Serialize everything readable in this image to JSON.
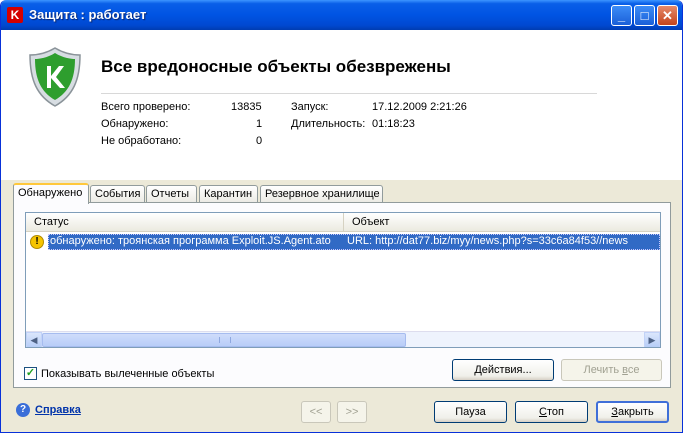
{
  "window": {
    "title": "Защита : работает",
    "logo_letter": "K"
  },
  "header": {
    "title": "Все вредоносные объекты обезврежены",
    "stats": {
      "checked_label": "Всего проверено:",
      "checked_value": "13835",
      "found_label": "Обнаружено:",
      "found_value": "1",
      "unprocessed_label": "Не обработано:",
      "unprocessed_value": "0",
      "start_label": "Запуск:",
      "start_value": "17.12.2009 2:21:26",
      "duration_label": "Длительность:",
      "duration_value": "01:18:23"
    }
  },
  "tabs": [
    "Обнаружено",
    "События",
    "Отчеты",
    "Карантин",
    "Резервное хранилище"
  ],
  "table": {
    "columns": [
      "Статус",
      "Объект"
    ],
    "rows": [
      {
        "status": "обнаружено: троянская программа Exploit.JS.Agent.ato",
        "object": "URL: http://dat77.biz/myy/news.php?s=33c6a84f53//news"
      }
    ]
  },
  "show_cured": {
    "label": "Показывать вылеченные объекты",
    "checked": true
  },
  "buttons": {
    "actions": "Действия...",
    "cure_prefix": "Лечить ",
    "cure_accel": "в",
    "cure_suffix": "се",
    "prev": "<<",
    "next": ">>",
    "pause": "Пауза",
    "stop_accel": "С",
    "stop_suffix": "топ",
    "close_accel": "З",
    "close_suffix": "акрыть"
  },
  "help": {
    "label": "Справка"
  },
  "colors": {
    "titlebar": "#0054e3",
    "selection": "#316ac5",
    "link": "#0033aa",
    "shield_green": "#2e9e2e"
  }
}
